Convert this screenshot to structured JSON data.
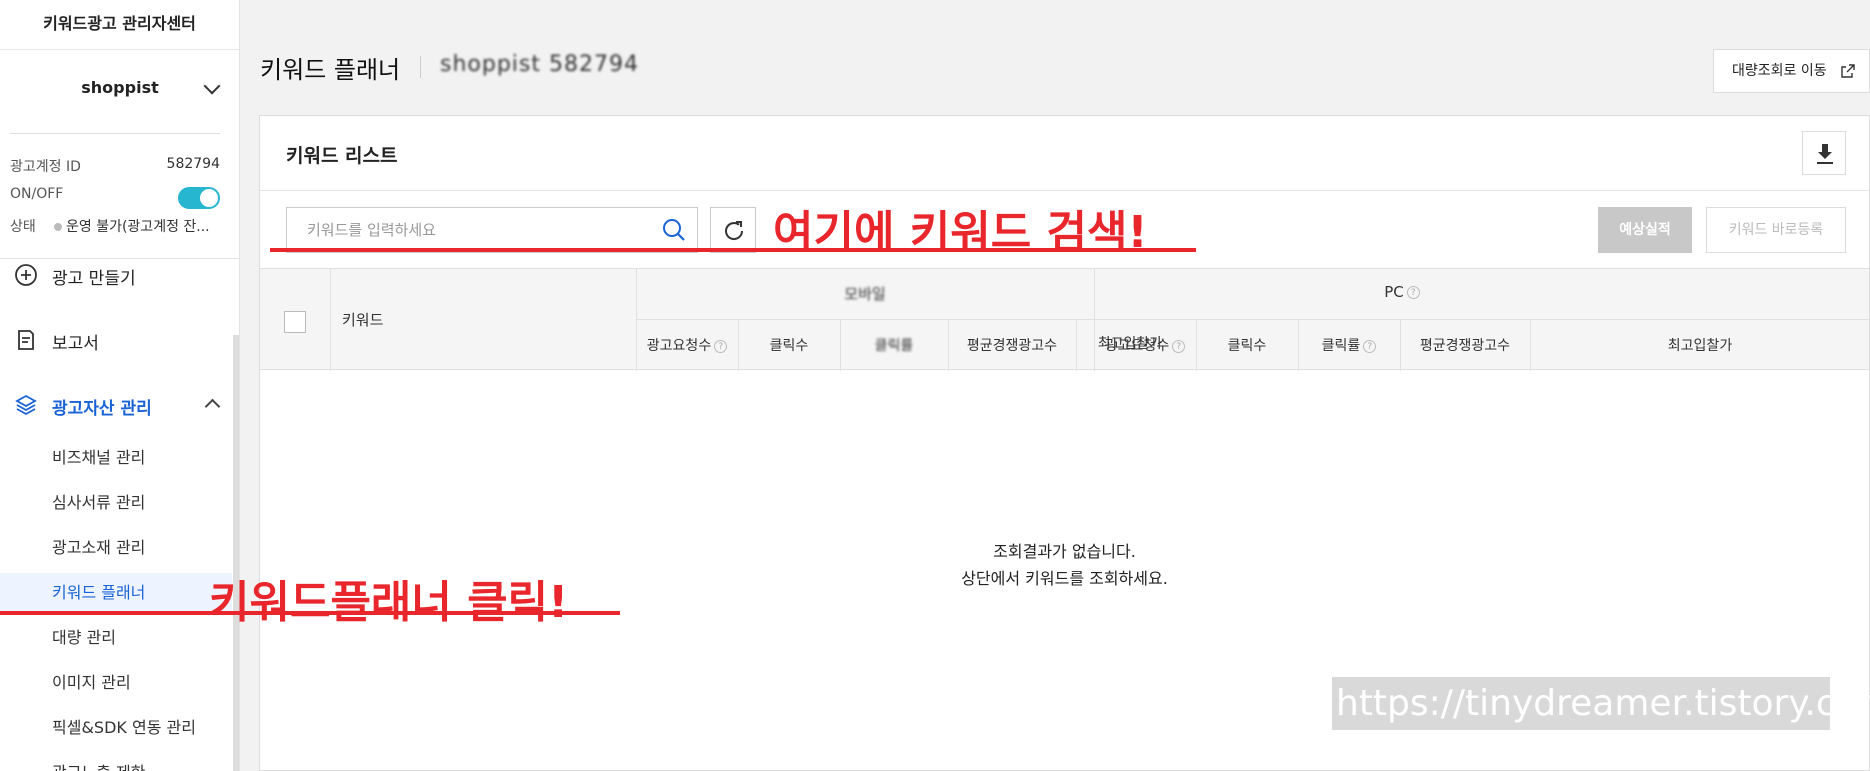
{
  "sidebar": {
    "title": "키워드광고 관리자센터",
    "account_name": "shoppist",
    "account_id_label": "광고계정 ID",
    "account_id": "582794",
    "onoff_label": "ON/OFF",
    "status_label": "상태",
    "status_value": "운영 불가(광고계정 잔...",
    "nav": {
      "create": "광고 만들기",
      "report": "보고서",
      "assets": "광고자산 관리"
    },
    "sub_items": [
      "비즈채널 관리",
      "심사서류 관리",
      "광고소재 관리",
      "키워드 플래너",
      "대량 관리",
      "이미지 관리",
      "픽셀&SDK 연동 관리",
      "광고노출 제한"
    ]
  },
  "header": {
    "title": "키워드 플래너",
    "account_label": "shoppist 582794",
    "bulk_button": "대량조회로 이동"
  },
  "panel": {
    "title": "키워드 리스트",
    "search_placeholder": "키워드를 입력하세요",
    "estimate_button": "예상실적",
    "register_button": "키워드 바로등록"
  },
  "table": {
    "keyword_col": "키워드",
    "mobile_group": "모바일",
    "pc_group": "PC",
    "mobile_cols": [
      "광고요청수",
      "클릭수",
      "클릭률",
      "평균경쟁광고수",
      "최고입찰가"
    ],
    "pc_cols": [
      "광고요청수",
      "클릭수",
      "클릭률",
      "평균경쟁광고수",
      "최고입찰가"
    ],
    "empty_line1": "조회결과가 없습니다.",
    "empty_line2": "상단에서 키워드를 조회하세요."
  },
  "annotations": {
    "search_hint": "여기에 키워드 검색!",
    "planner_hint": "키워드플래너 클릭!",
    "watermark": "https://tinydreamer.tistory.com"
  },
  "colors": {
    "accent": "#1a63d6",
    "toggle": "#27b6cf",
    "annotation": "#e8262b"
  }
}
